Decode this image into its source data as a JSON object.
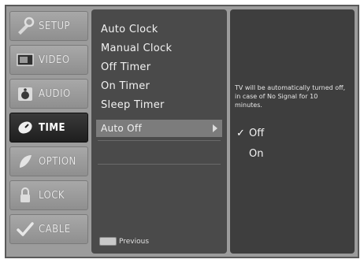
{
  "sidebar": {
    "items": [
      {
        "label": "SETUP",
        "icon": "setup-icon",
        "active": false
      },
      {
        "label": "VIDEO",
        "icon": "video-icon",
        "active": false
      },
      {
        "label": "AUDIO",
        "icon": "audio-icon",
        "active": false
      },
      {
        "label": "TIME",
        "icon": "time-icon",
        "active": true
      },
      {
        "label": "OPTION",
        "icon": "option-icon",
        "active": false
      },
      {
        "label": "LOCK",
        "icon": "lock-icon",
        "active": false
      },
      {
        "label": "CABLE",
        "icon": "cable-icon",
        "active": false
      }
    ]
  },
  "menu": {
    "items": [
      {
        "label": "Auto Clock"
      },
      {
        "label": "Manual Clock"
      },
      {
        "label": "Off Timer"
      },
      {
        "label": "On Timer"
      },
      {
        "label": "Sleep Timer"
      },
      {
        "label": "Auto Off"
      }
    ],
    "prev_label": "Previous"
  },
  "info": {
    "description": "TV will be automatically turned off, in case of No Signal for 10 minutes.",
    "options": [
      {
        "label": "Off",
        "checked": true
      },
      {
        "label": "On",
        "checked": false
      }
    ],
    "check_glyph": "✓"
  }
}
